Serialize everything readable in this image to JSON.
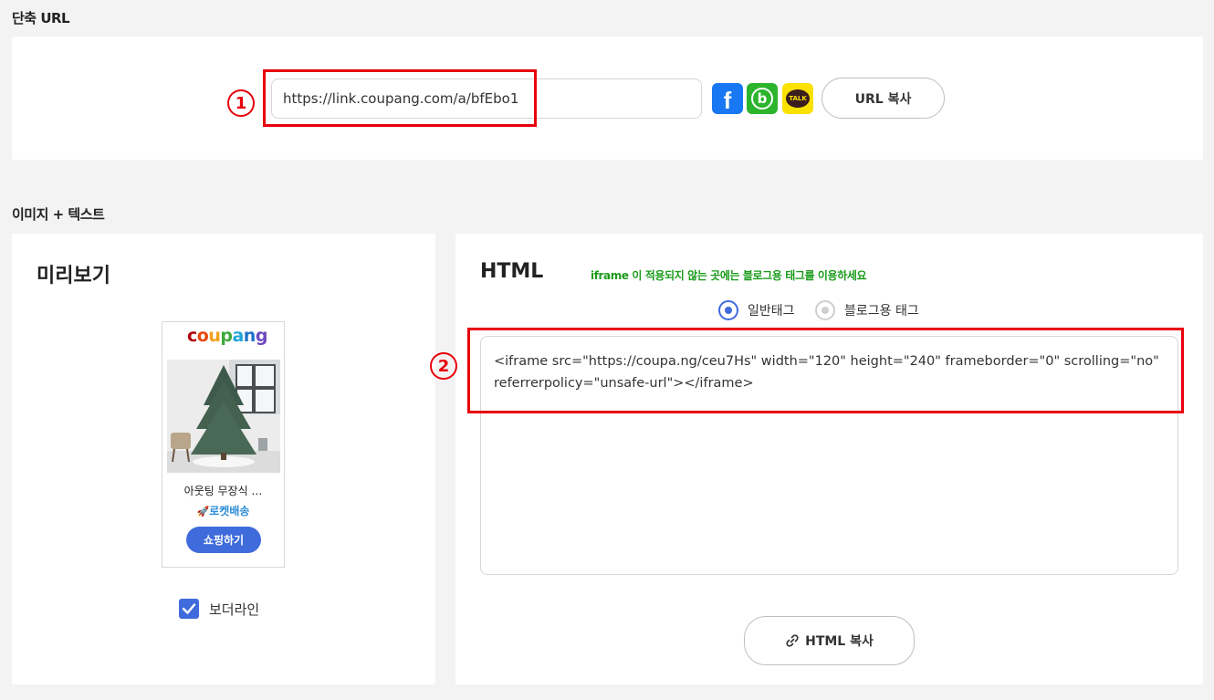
{
  "short_url": {
    "section_title": "단축 URL",
    "url_value": "https://link.coupang.com/a/bfEbo1",
    "marker": "1",
    "copy_label": "URL 복사",
    "share_icons": [
      "facebook-icon",
      "band-icon",
      "kakaotalk-icon"
    ],
    "kakao_text": "TALK",
    "band_letter": "b",
    "facebook_letter": "f"
  },
  "image_text": {
    "section_title": "이미지 + 텍스트"
  },
  "preview": {
    "title": "미리보기",
    "logo": [
      "c",
      "o",
      "u",
      "p",
      "a",
      "n",
      "g"
    ],
    "product_name": "아웃팅 무장식 …",
    "rocket_label": "로켓배송",
    "shop_label": "쇼핑하기",
    "border_label": "보더라인",
    "border_checked": true
  },
  "html_panel": {
    "title": "HTML",
    "notice": "iframe 이 적용되지 않는 곳에는 블로그용 태그를 이용하세요",
    "tag_options": [
      {
        "label": "일반태그",
        "selected": true
      },
      {
        "label": "블로그용 태그",
        "selected": false
      }
    ],
    "marker": "2",
    "code": "<iframe src=\"https://coupa.ng/ceu7Hs\" width=\"120\" height=\"240\" frameborder=\"0\" scrolling=\"no\" referrerpolicy=\"unsafe-url\"></iframe>",
    "copy_label": "HTML 복사"
  },
  "colors": {
    "accent": "#3f6bdc",
    "highlight": "#e8000b",
    "notice": "#1a9b1a"
  }
}
